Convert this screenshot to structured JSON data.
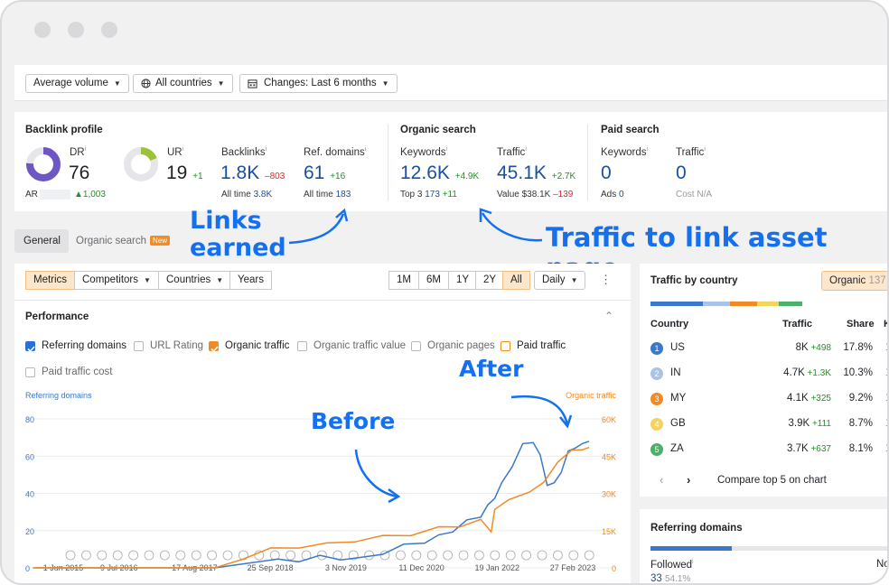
{
  "filters": {
    "volume": "Average volume",
    "countries": "All countries",
    "changes": "Changes: Last 6 months"
  },
  "backlink_profile": {
    "title": "Backlink profile",
    "dr_label": "DR",
    "dr_value": "76",
    "ar_label": "AR",
    "ar_change": "▲1,003",
    "ur_label": "UR",
    "ur_value": "19",
    "ur_change": "+1",
    "backlinks_label": "Backlinks",
    "backlinks_value": "1.8K",
    "backlinks_change": "–803",
    "backlinks_alltime_label": "All time",
    "backlinks_alltime": "3.8K",
    "refdomains_label": "Ref. domains",
    "refdomains_value": "61",
    "refdomains_change": "+16",
    "refdomains_alltime_label": "All time",
    "refdomains_alltime": "183"
  },
  "organic_search": {
    "title": "Organic search",
    "keywords_label": "Keywords",
    "keywords_value": "12.6K",
    "keywords_change": "+4.9K",
    "top3_label": "Top 3",
    "top3_value": "173",
    "top3_change": "+11",
    "traffic_label": "Traffic",
    "traffic_value": "45.1K",
    "traffic_change": "+2.7K",
    "value_label": "Value",
    "value_value": "$38.1K",
    "value_change": "–139"
  },
  "paid_search": {
    "title": "Paid search",
    "keywords_label": "Keywords",
    "keywords_value": "0",
    "traffic_label": "Traffic",
    "traffic_value": "0",
    "ads_label": "Ads",
    "ads_value": "0",
    "cost_label": "Cost",
    "cost_value": "N/A"
  },
  "annotations": {
    "links_line1": "Links",
    "links_line2": "earned",
    "traffic": "Traffic to link asset page",
    "before": "Before",
    "after": "After"
  },
  "tabs": {
    "general": "General",
    "organic": "Organic search",
    "new_badge": "New"
  },
  "chart_controls": {
    "metrics": "Metrics",
    "competitors": "Competitors",
    "countries": "Countries",
    "years": "Years",
    "ranges": [
      "1M",
      "6M",
      "1Y",
      "2Y",
      "All"
    ],
    "active_range": "All",
    "interval": "Daily"
  },
  "performance": {
    "title": "Performance",
    "options": [
      {
        "label": "Referring domains",
        "state": "checked-blue"
      },
      {
        "label": "URL Rating",
        "state": "off"
      },
      {
        "label": "Organic traffic",
        "state": "checked-orange"
      },
      {
        "label": "Organic traffic value",
        "state": "off"
      },
      {
        "label": "Organic pages",
        "state": "off"
      },
      {
        "label": "Paid traffic",
        "state": "outline-orange"
      },
      {
        "label": "Paid traffic cost",
        "state": "off"
      }
    ]
  },
  "chart_data": {
    "type": "line",
    "left_axis_label": "Referring domains",
    "right_axis_label": "Organic traffic",
    "left_ticks": [
      "80",
      "60",
      "40",
      "20",
      "0"
    ],
    "right_ticks": [
      "60K",
      "45K",
      "30K",
      "15K",
      "0"
    ],
    "x_ticks": [
      "1 Jun 2015",
      "9 Jul 2016",
      "17 Aug 2017",
      "25 Sep 2018",
      "3 Nov 2019",
      "11 Dec 2020",
      "19 Jan 2022",
      "27 Feb 2023"
    ],
    "ylim_left": [
      0,
      80
    ],
    "ylim_right": [
      0,
      60000
    ],
    "series": [
      {
        "name": "Referring domains",
        "color": "#3b78c9",
        "x": [
          2015.4,
          2016.0,
          2017.0,
          2018.0,
          2018.9,
          2019.2,
          2019.5,
          2019.8,
          2020.1,
          2020.4,
          2020.7,
          2021.0,
          2021.2,
          2021.4,
          2021.6,
          2021.8,
          2021.9,
          2022.0,
          2022.1,
          2022.25,
          2022.4,
          2022.55,
          2022.65,
          2022.75,
          2022.85,
          2022.95,
          2023.05,
          2023.15,
          2023.25,
          2023.35
        ],
        "values": [
          0,
          0,
          0,
          0,
          4,
          4,
          6,
          5,
          5,
          8,
          12,
          14,
          17,
          20,
          25,
          28,
          33,
          38,
          45,
          55,
          66,
          68,
          60,
          45,
          45,
          52,
          62,
          65,
          66,
          68
        ]
      },
      {
        "name": "Organic traffic",
        "color": "#f08a24",
        "x": [
          2015.4,
          2017.0,
          2018.0,
          2018.4,
          2018.8,
          2019.2,
          2019.6,
          2020.0,
          2020.4,
          2020.8,
          2021.2,
          2021.5,
          2021.8,
          2021.95,
          2022.0,
          2022.2,
          2022.5,
          2022.7,
          2022.9,
          2023.1,
          2023.25,
          2023.35
        ],
        "values": [
          0,
          0,
          0,
          3500,
          7500,
          8500,
          9500,
          11000,
          12500,
          13500,
          16000,
          17000,
          19000,
          15000,
          23000,
          28000,
          30000,
          35000,
          42000,
          48000,
          47000,
          48500
        ]
      }
    ]
  },
  "traffic_by_country": {
    "title": "Traffic by country",
    "badge_label": "Organic",
    "badge_value": "137",
    "bar_colors": [
      "#3b78c9",
      "#a9c4e8",
      "#f08a24",
      "#f4d35e",
      "#4caf6a"
    ],
    "headers": [
      "Country",
      "Traffic",
      "Share",
      "K"
    ],
    "rows": [
      {
        "rank": "1",
        "color": "#3b78c9",
        "country": "US",
        "traffic": "8K",
        "change": "+498",
        "share": "17.8%",
        "k": "1"
      },
      {
        "rank": "2",
        "color": "#a9c4e8",
        "country": "IN",
        "traffic": "4.7K",
        "change": "+1.3K",
        "share": "10.3%",
        "k": "1"
      },
      {
        "rank": "3",
        "color": "#f08a24",
        "country": "MY",
        "traffic": "4.1K",
        "change": "+325",
        "share": "9.2%",
        "k": "1"
      },
      {
        "rank": "4",
        "color": "#f4d35e",
        "country": "GB",
        "traffic": "3.9K",
        "change": "+111",
        "share": "8.7%",
        "k": "1"
      },
      {
        "rank": "5",
        "color": "#4caf6a",
        "country": "ZA",
        "traffic": "3.7K",
        "change": "+637",
        "share": "8.1%",
        "k": "1"
      }
    ],
    "compare_label": "Compare top 5 on chart"
  },
  "referring_domains": {
    "title": "Referring domains",
    "followed_label": "Followed",
    "followed_value": "33",
    "followed_share": "54.1%",
    "nofollow_label": "No",
    "bar_fraction": 0.54
  }
}
